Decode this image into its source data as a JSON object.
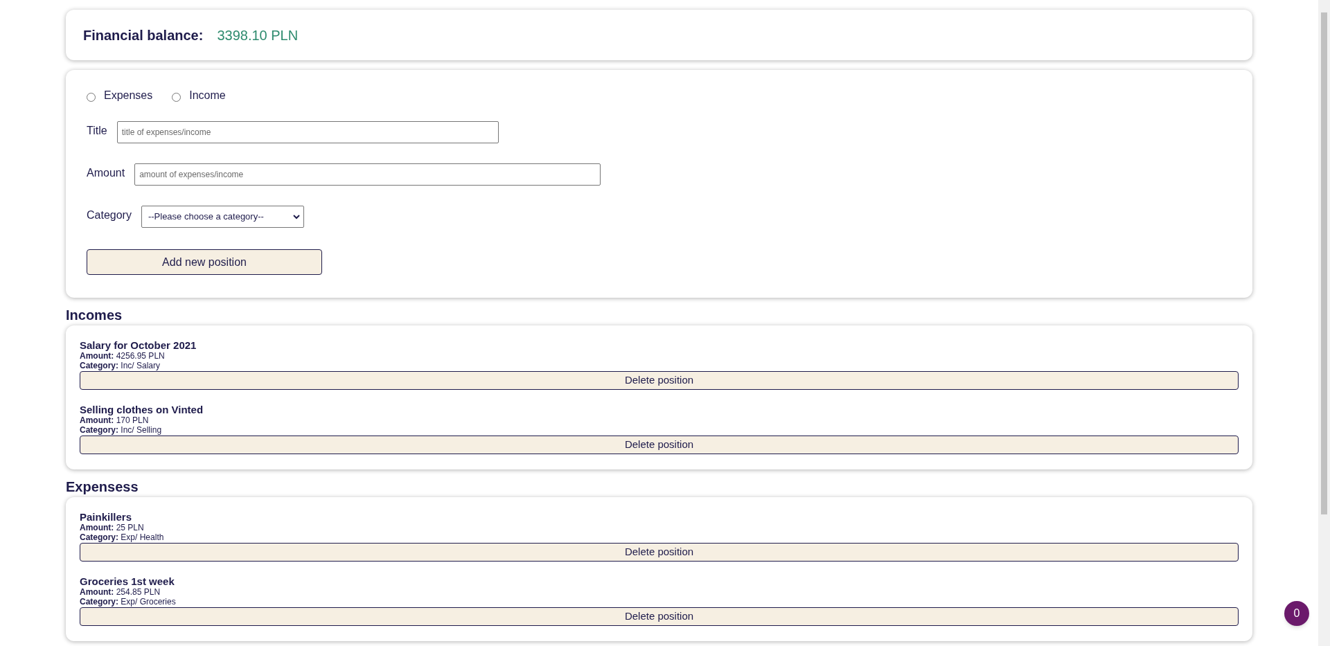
{
  "balance": {
    "label": "Financial balance:",
    "value": "3398.10 PLN"
  },
  "form": {
    "types": [
      {
        "label": "Expenses",
        "selected": false
      },
      {
        "label": "Income",
        "selected": false
      }
    ],
    "title": {
      "label": "Title",
      "placeholder": "title of expenses/income"
    },
    "amount": {
      "label": "Amount",
      "placeholder": "amount of expenses/income"
    },
    "category": {
      "label": "Category",
      "value": "--Please choose a category--"
    },
    "submit": "Add new position"
  },
  "sections": [
    {
      "heading": "Incomes",
      "items": [
        {
          "title": "Salary for October 2021",
          "amount": "**Amount:** 4256.95 PLN",
          "category": "**Category:** Inc/ Salary",
          "button": "Delete position"
        },
        {
          "title": "Selling clothes on Vinted",
          "amount": "**Amount:** 170 PLN",
          "category": "**Category:** Inc/ Selling",
          "button": "Delete position"
        }
      ]
    },
    {
      "heading": "Expensess",
      "items": [
        {
          "title": "Painkillers",
          "amount": "**Amount:** 25 PLN",
          "category": "**Category:** Exp/ Health",
          "button": "Delete position"
        },
        {
          "title": "Groceries 1st week",
          "amount": "**Amount:** 254.85 PLN",
          "category": "**Category:** Exp/ Groceries",
          "button": "Delete position"
        }
      ]
    }
  ],
  "badge": "0"
}
